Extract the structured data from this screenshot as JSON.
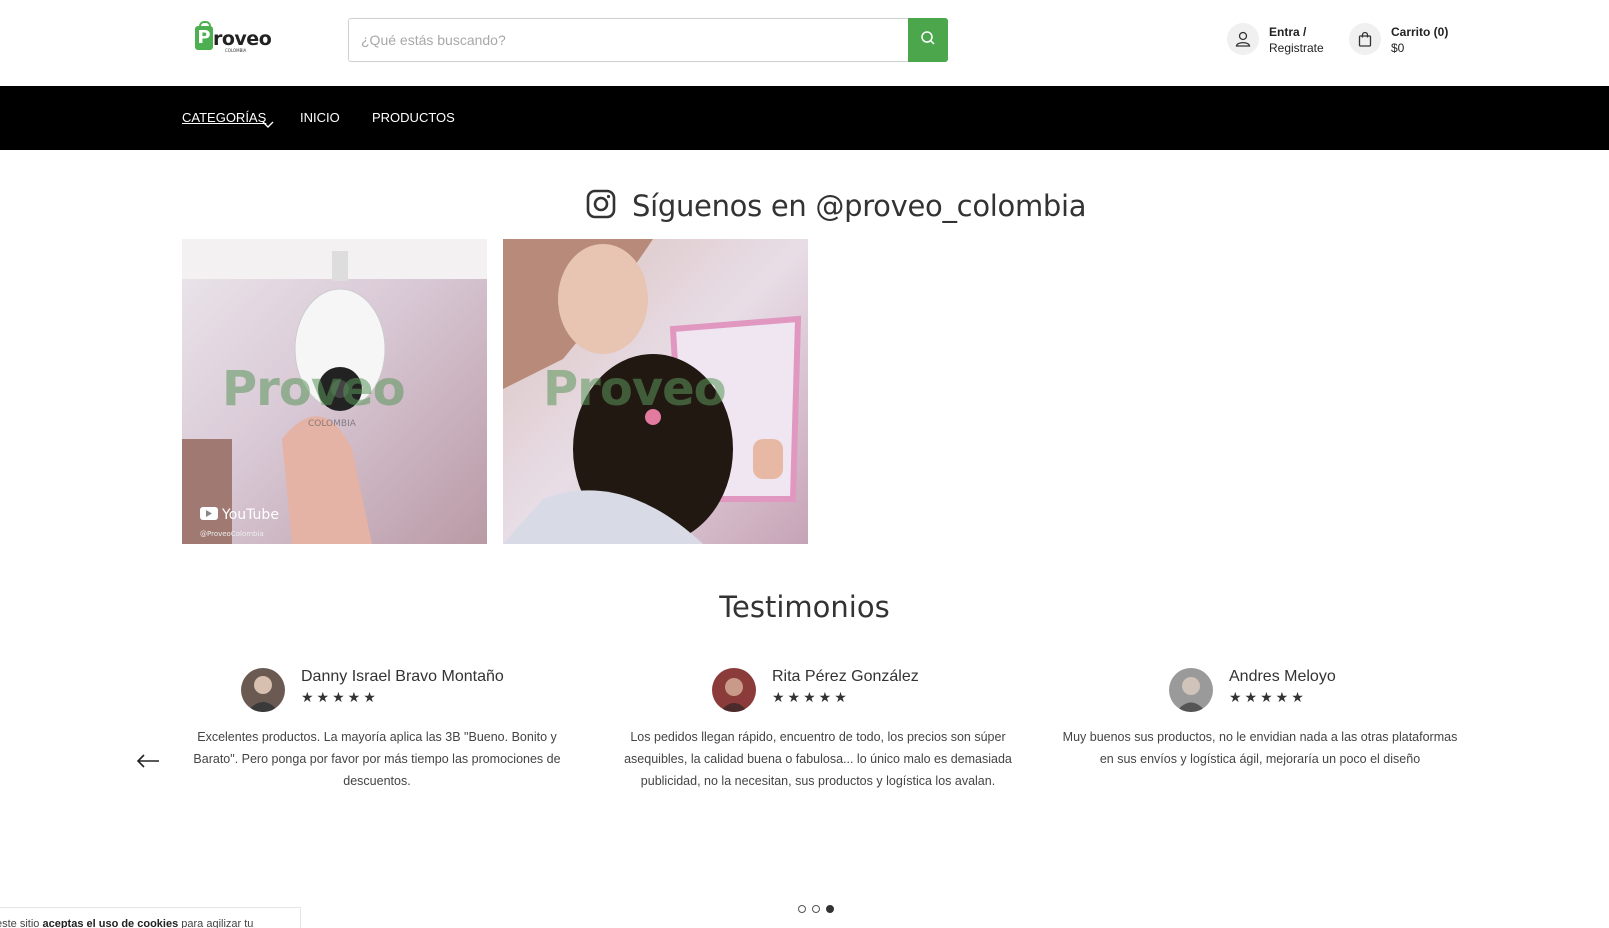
{
  "header": {
    "logo_text": "roveo",
    "logo_mark": "P",
    "logo_sub": "COLOMBIA",
    "search_placeholder": "¿Qué estás buscando?",
    "account_line1": "Entra /",
    "account_line2": "Registrate",
    "cart_line1": "Carrito (0)",
    "cart_line2": "$0"
  },
  "nav": {
    "categories": "CATEGORÍAS",
    "home": "INICIO",
    "products": "PRODUCTOS"
  },
  "instagram": {
    "title": "Síguenos en @proveo_colombia",
    "posts": [
      {
        "watermark": "Proveo",
        "watermark_sub": "COLOMBIA",
        "badge": "YouTube",
        "handle": "@ProveoColombia"
      },
      {
        "watermark": "Proveo"
      }
    ]
  },
  "testimonials": {
    "title": "Testimonios",
    "items": [
      {
        "name": "Danny Israel Bravo Montaño",
        "stars": "★★★★★",
        "text": "Excelentes productos. La mayoría aplica las 3B \"Bueno. Bonito y Barato\". Pero ponga por favor por más tiempo las promociones de descuentos."
      },
      {
        "name": "Rita Pérez González",
        "stars": "★★★★★",
        "text": "Los pedidos llegan rápido, encuentro de todo, los precios son súper asequibles, la calidad buena o fabulosa... lo único malo es demasiada publicidad, no la necesitan, sus productos y logística los avalan."
      },
      {
        "name": "Andres Meloyo",
        "stars": "★★★★★",
        "text": "Muy buenos sus productos, no le envidian nada a las otras plataformas en sus envíos y logística ágil, mejoraría un poco el diseño"
      }
    ],
    "active_page": 3,
    "page_count": 3
  },
  "cookie": {
    "prefix": "este sitio ",
    "bold": "aceptas el uso de cookies",
    "suffix": " para agilizar tu"
  },
  "colors": {
    "brand_green": "#4ca64c",
    "nav_bg": "#000000"
  },
  "icons": [
    "search-icon",
    "user-icon",
    "bag-icon",
    "chevron-down-icon",
    "instagram-icon",
    "arrow-left-icon"
  ]
}
